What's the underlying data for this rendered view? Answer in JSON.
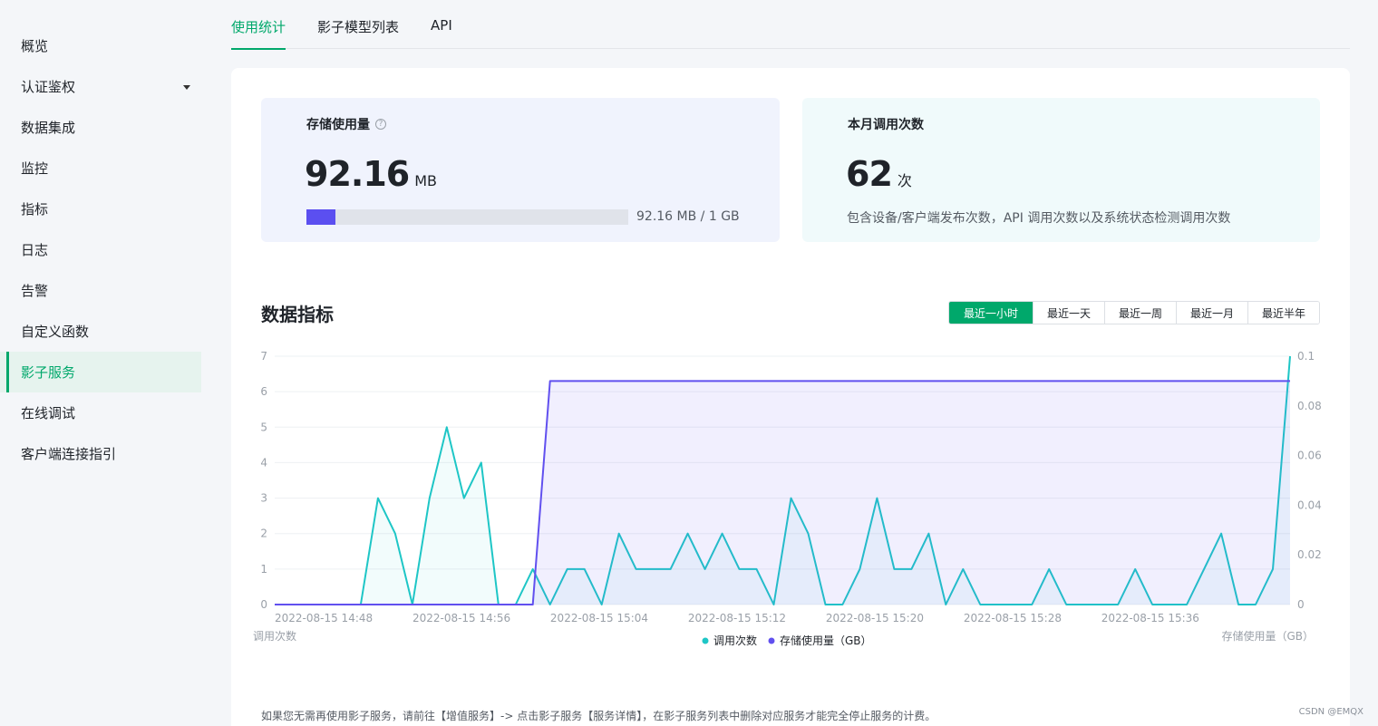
{
  "sidebar": {
    "items": [
      {
        "label": "概览",
        "active": false
      },
      {
        "label": "认证鉴权",
        "active": false,
        "has_caret": true
      },
      {
        "label": "数据集成",
        "active": false
      },
      {
        "label": "监控",
        "active": false
      },
      {
        "label": "指标",
        "active": false
      },
      {
        "label": "日志",
        "active": false
      },
      {
        "label": "告警",
        "active": false
      },
      {
        "label": "自定义函数",
        "active": false
      },
      {
        "label": "影子服务",
        "active": true
      },
      {
        "label": "在线调试",
        "active": false
      },
      {
        "label": "客户端连接指引",
        "active": false
      }
    ]
  },
  "tabs": [
    {
      "label": "使用统计",
      "active": true
    },
    {
      "label": "影子模型列表",
      "active": false
    },
    {
      "label": "API",
      "active": false
    }
  ],
  "storage": {
    "title": "存储使用量",
    "value": "92.16",
    "unit": "MB",
    "progress_fraction": 0.09,
    "progress_label": "92.16 MB / 1 GB"
  },
  "calls": {
    "title": "本月调用次数",
    "value": "62",
    "unit": "次",
    "description": "包含设备/客户端发布次数，API 调用次数以及系统状态检测调用次数"
  },
  "metrics": {
    "title": "数据指标",
    "ranges": [
      {
        "label": "最近一小时",
        "active": true
      },
      {
        "label": "最近一天",
        "active": false
      },
      {
        "label": "最近一周",
        "active": false
      },
      {
        "label": "最近一月",
        "active": false
      },
      {
        "label": "最近半年",
        "active": false
      }
    ]
  },
  "chart_data": {
    "type": "line",
    "x_ticks": [
      "2022-08-15 14:48",
      "2022-08-15 14:56",
      "2022-08-15 15:04",
      "2022-08-15 15:12",
      "2022-08-15 15:20",
      "2022-08-15 15:28",
      "2022-08-15 15:36"
    ],
    "y_left": {
      "label": "调用次数",
      "min": 0,
      "max": 7,
      "ticks": [
        "0",
        "1",
        "2",
        "3",
        "4",
        "5",
        "6",
        "7"
      ]
    },
    "y_right": {
      "label": "存储使用量（GB）",
      "min": 0,
      "max": 0.1,
      "ticks": [
        "0",
        "0.02",
        "0.04",
        "0.06",
        "0.08",
        "0.1"
      ]
    },
    "grid": true,
    "legend_position": "bottom",
    "series": [
      {
        "name": "调用次数",
        "axis": "left",
        "color": "#1ec6c6",
        "values": [
          0,
          0,
          0,
          0,
          0,
          0,
          3,
          2,
          0,
          3,
          5,
          3,
          4,
          0,
          0,
          1,
          0,
          1,
          1,
          0,
          2,
          1,
          1,
          1,
          2,
          1,
          2,
          1,
          1,
          0,
          3,
          2,
          0,
          0,
          1,
          3,
          1,
          1,
          2,
          0,
          1,
          0,
          0,
          0,
          0,
          1,
          0,
          0,
          0,
          0,
          1,
          0,
          0,
          0,
          1,
          2,
          0,
          0,
          1,
          7
        ]
      },
      {
        "name": "存储使用量（GB）",
        "axis": "right",
        "color": "#6150ef",
        "values": [
          0,
          0,
          0,
          0,
          0,
          0,
          0,
          0,
          0,
          0,
          0,
          0,
          0,
          0,
          0,
          0,
          0.09,
          0.09,
          0.09,
          0.09,
          0.09,
          0.09,
          0.09,
          0.09,
          0.09,
          0.09,
          0.09,
          0.09,
          0.09,
          0.09,
          0.09,
          0.09,
          0.09,
          0.09,
          0.09,
          0.09,
          0.09,
          0.09,
          0.09,
          0.09,
          0.09,
          0.09,
          0.09,
          0.09,
          0.09,
          0.09,
          0.09,
          0.09,
          0.09,
          0.09,
          0.09,
          0.09,
          0.09,
          0.09,
          0.09,
          0.09,
          0.09,
          0.09,
          0.09,
          0.09
        ]
      }
    ]
  },
  "footnote": "如果您无需再使用影子服务，请前往【增值服务】-> 点击影子服务【服务详情】，在影子服务列表中删除对应服务才能完全停止服务的计费。",
  "watermark": "CSDN @EMQX"
}
